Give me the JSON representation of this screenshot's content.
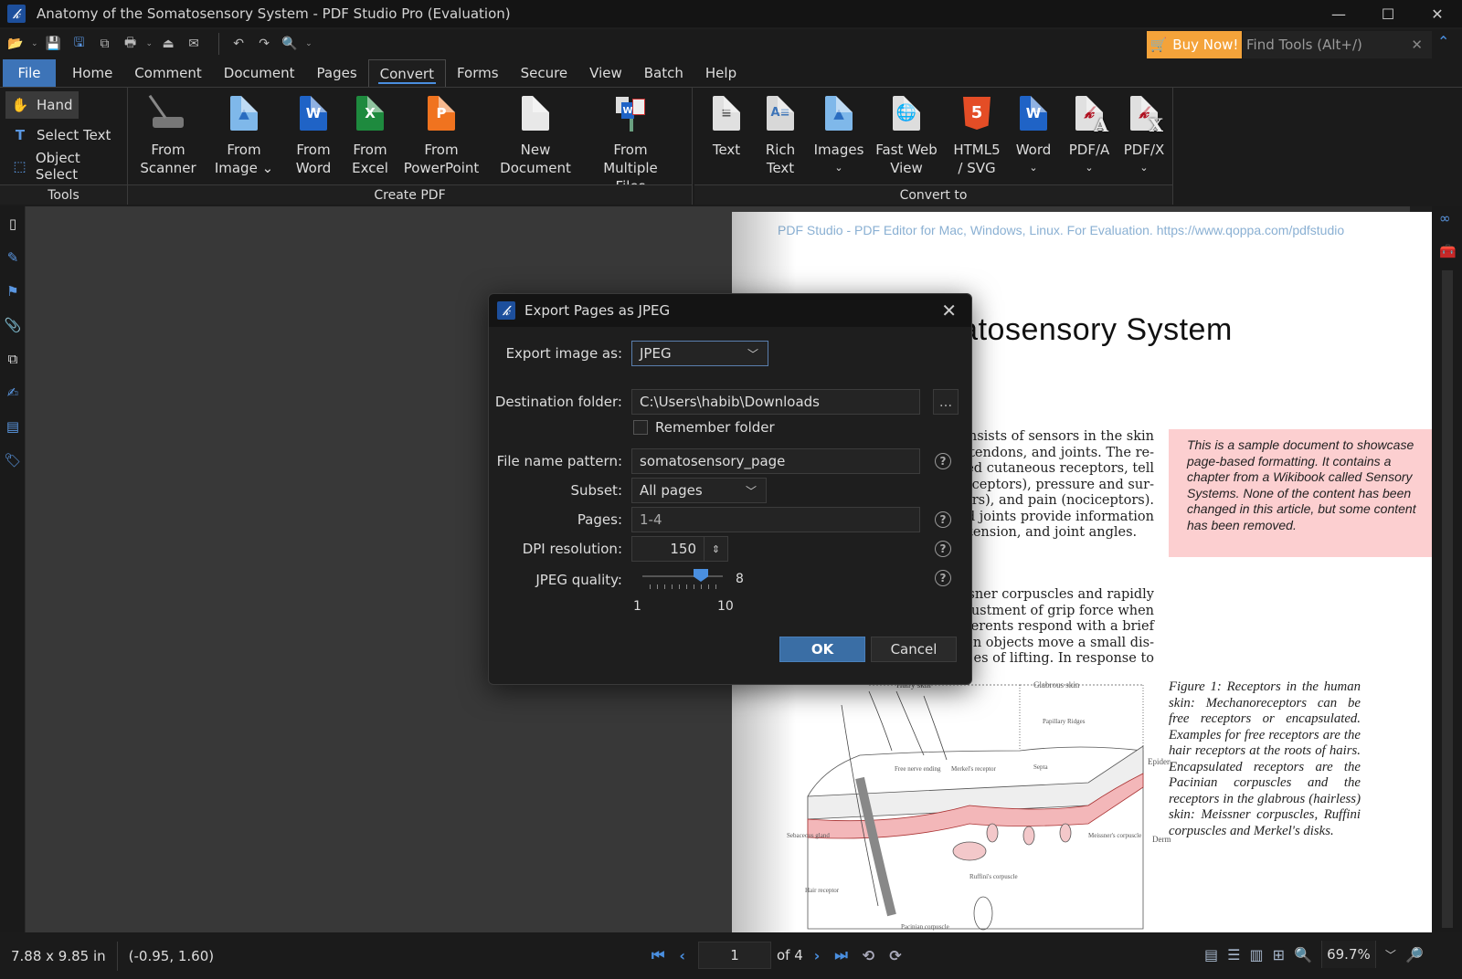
{
  "window": {
    "title": "Anatomy of the Somatosensory System - PDF Studio Pro (Evaluation)",
    "logo_glyph": "𝓀",
    "minimize": "—",
    "maximize": "☐",
    "close": "✕"
  },
  "quick_access": {
    "buy_now": "Buy Now!",
    "find_tools_placeholder": "Find Tools  (Alt+/)",
    "find_clear": "✕",
    "collapse_ribbon": "⌃"
  },
  "menu": {
    "items": [
      "File",
      "Home",
      "Comment",
      "Document",
      "Pages",
      "Convert",
      "Forms",
      "Secure",
      "View",
      "Batch",
      "Help"
    ],
    "active": "Convert"
  },
  "ribbon": {
    "tools_group": {
      "label": "Tools",
      "items": [
        {
          "label": "Hand",
          "icon": "hand-icon",
          "glyph": "✋",
          "selected": true
        },
        {
          "label": "Select Text",
          "icon": "select-text-icon",
          "glyph": "T",
          "selected": false
        },
        {
          "label": "Object Select",
          "icon": "object-select-icon",
          "glyph": "⬚",
          "selected": false
        }
      ]
    },
    "create_group": {
      "label": "Create PDF",
      "items": [
        {
          "line1": "From",
          "line2": "Scanner",
          "icon": "scanner-icon"
        },
        {
          "line1": "From",
          "line2": "Image ⌄",
          "icon": "image-file-icon"
        },
        {
          "line1": "From",
          "line2": "Word",
          "icon": "word-file-icon",
          "letter": "W"
        },
        {
          "line1": "From",
          "line2": "Excel",
          "icon": "excel-file-icon",
          "letter": "X"
        },
        {
          "line1": "From",
          "line2": "PowerPoint",
          "icon": "powerpoint-file-icon",
          "letter": "P"
        },
        {
          "line1": "New",
          "line2": "Document",
          "icon": "blank-document-icon"
        },
        {
          "line1": "From Multiple",
          "line2": "Files",
          "icon": "multiple-files-icon"
        }
      ]
    },
    "convert_group": {
      "label": "Convert to",
      "items": [
        {
          "line1": "Text",
          "line2": "",
          "icon": "text-file-icon"
        },
        {
          "line1": "Rich",
          "line2": "Text",
          "icon": "rich-text-icon"
        },
        {
          "line1": "Images",
          "line2": "⌄",
          "icon": "images-icon"
        },
        {
          "line1": "Fast Web",
          "line2": "View",
          "icon": "web-view-icon"
        },
        {
          "line1": "HTML5",
          "line2": "/ SVG",
          "icon": "html5-icon",
          "letter": "5"
        },
        {
          "line1": "Word",
          "line2": "⌄",
          "icon": "word-export-icon",
          "letter": "W"
        },
        {
          "line1": "PDF/A",
          "line2": "⌄",
          "icon": "pdfa-icon",
          "letter": "A"
        },
        {
          "line1": "PDF/X",
          "line2": "⌄",
          "icon": "pdfx-icon",
          "letter": "X"
        }
      ]
    }
  },
  "document": {
    "watermark": "PDF Studio - PDF Editor for Mac, Windows, Linux. For Evaluation. https://www.qoppa.com/pdfstudio",
    "title_partial": "he Somatosensory System",
    "para1": [
      "onsists of sensors in the skin",
      "tendons, and joints. The re-",
      "lled cutaneous receptors, tell",
      "oreceptors), pressure and sur-",
      "tors), and pain (nociceptors).",
      "d joints provide information",
      "tension, and joint angles."
    ],
    "para2": [
      "eissner corpuscles and rapidly",
      "djustment of grip force when",
      "ferents respond with a brief",
      "nen objects move a small dis-",
      "es of lifting. In response to"
    ],
    "sidebar_note": "This is a sample document to showcase page-based formatting. It contains a chapter from a Wikibook called Sensory Systems. None of the content has been changed in this article, but some content has been removed.",
    "figure_caption": "Figure 1:  Receptors in the human skin: Mechanoreceptors can be free receptors or encapsulated. Examples for free receptors are the hair receptors at the roots of hairs. Encapsulated receptors are the Pacinian corpuscles and the receptors in the glabrous (hairless) skin: Meissner corpuscles, Ruffini corpuscles and Merkel's disks.",
    "figure_labels": {
      "hairy": "Hairy skin",
      "glabrous": "Glabrous skin",
      "papillary": "Papillary Ridges",
      "epidermis": "Epidermis",
      "dermis": "Dermis",
      "septa": "Septa",
      "free_nerve": "Free nerve ending",
      "merkel": "Merkel's receptor",
      "sebaceous": "Sebaceous gland",
      "meissner": "Meissner's corpuscle",
      "ruffini": "Ruffini's corpuscle",
      "hair_receptor": "Hair receptor",
      "pacinian": "Pacinian corpuscle"
    }
  },
  "dialog": {
    "title": "Export Pages as JPEG",
    "export_as_label": "Export image as:",
    "export_as_value": "JPEG",
    "destination_label": "Destination folder:",
    "destination_value": "C:\\Users\\habib\\Downloads",
    "browse": "...",
    "remember_label": "Remember folder",
    "remember_checked": false,
    "pattern_label": "File name pattern:",
    "pattern_value": "somatosensory_page",
    "subset_label": "Subset:",
    "subset_value": "All pages",
    "pages_label": "Pages:",
    "pages_value": "1-4",
    "dpi_label": "DPI resolution:",
    "dpi_value": "150",
    "quality_label": "JPEG quality:",
    "quality_value": 8,
    "quality_display": "8",
    "quality_min": "1",
    "quality_max": "10",
    "ok": "OK",
    "cancel": "Cancel",
    "help_glyph": "?"
  },
  "status": {
    "page_size": "7.88 x 9.85 in",
    "cursor": "(-0.95, 1.60)",
    "current_page": "1",
    "page_count": "of 4",
    "zoom": "69.7%"
  },
  "colors": {
    "accent": "#4a8fe0",
    "file_tab": "#3d74b8",
    "buy_now": "#f4a33a",
    "ok_button": "#3a6ea5",
    "pink_note": "#fccfd0"
  }
}
